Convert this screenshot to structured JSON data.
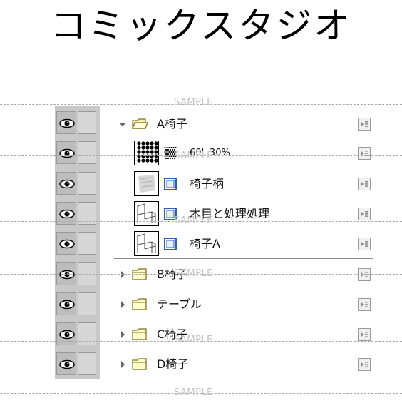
{
  "title": "コミックスタジオ",
  "watermark": "SAMPLE",
  "layers": [
    {
      "kind": "folder",
      "expanded": true,
      "indent": 0,
      "name": "A椅子"
    },
    {
      "kind": "tone",
      "indent": 1,
      "name": "60L 30%"
    },
    {
      "kind": "raster",
      "indent": 1,
      "name": "椅子柄"
    },
    {
      "kind": "raster",
      "indent": 1,
      "name": "木目と処理処理"
    },
    {
      "kind": "raster",
      "indent": 1,
      "name": "椅子A"
    },
    {
      "kind": "folder",
      "expanded": false,
      "indent": 0,
      "name": "B椅子"
    },
    {
      "kind": "folder",
      "expanded": false,
      "indent": 0,
      "name": "テーブル"
    },
    {
      "kind": "folder",
      "expanded": false,
      "indent": 0,
      "name": "C椅子"
    },
    {
      "kind": "folder",
      "expanded": false,
      "indent": 0,
      "name": "D椅子"
    }
  ],
  "icons": {
    "visibility": "eye-icon",
    "lock": "lock-cell",
    "expand": "triangle-icon",
    "folder": "folder-icon",
    "raster_layer": "layer-icon",
    "tone_layer": "tone-icon",
    "menu": "layer-menu-icon"
  },
  "colors": {
    "eye_column": "#c8c8c8",
    "folder_fill": "#ffffcc",
    "layer_icon": "#2c5fb8"
  }
}
